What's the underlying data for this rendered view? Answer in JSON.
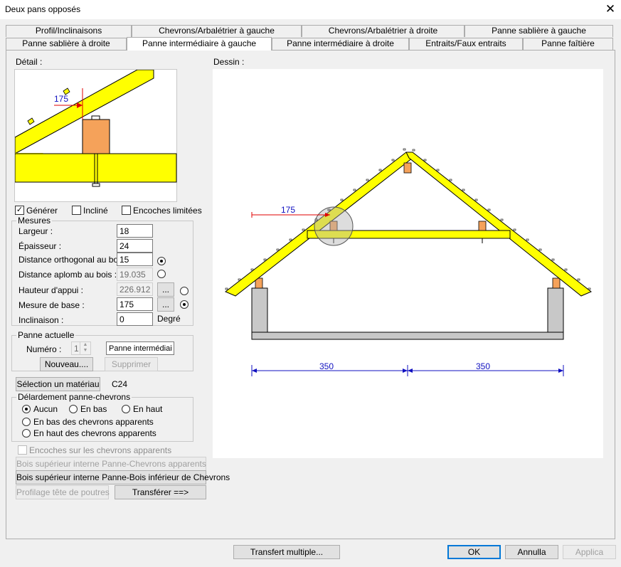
{
  "window": {
    "title": "Deux pans opposés"
  },
  "tabs_row1": [
    "Profil/Inclinaisons",
    "Chevrons/Arbalétrier à gauche",
    "Chevrons/Arbalétrier à droite",
    "Panne sablière à gauche"
  ],
  "tabs_row2": [
    "Panne sablière à droite",
    "Panne intermédiaire à gauche",
    "Panne intermédiaire à droite",
    "Entraits/Faux entraits",
    "Panne faîtière"
  ],
  "detail": {
    "label": "Détail :",
    "dim": "175"
  },
  "drawing": {
    "label": "Dessin :",
    "dim_left": "175",
    "span_left": "350",
    "span_right": "350"
  },
  "options": {
    "generer": "Générer",
    "incline": "Incliné",
    "encoches": "Encoches limitées"
  },
  "mesures": {
    "title": "Mesures",
    "largeur_label": "Largeur :",
    "largeur": "18",
    "epaisseur_label": "Épaisseur :",
    "epaisseur": "24",
    "dist_ortho_label": "Distance orthogonal au bois :",
    "dist_ortho": "15",
    "dist_aplomb_label": "Distance aplomb au bois :",
    "dist_aplomb": "19.035",
    "hauteur_label": "Hauteur d'appui :",
    "hauteur": "226.912",
    "mesure_base_label": "Mesure de base :",
    "mesure_base": "175",
    "inclinaison_label": "Inclinaison :",
    "inclinaison": "0",
    "degre": "Degré",
    "ellipsis": "..."
  },
  "panne": {
    "title": "Panne actuelle",
    "numero_label": "Numéro :",
    "numero": "1",
    "nom": "Panne intermédiaire",
    "nouveau": "Nouveau....",
    "supprimer": "Supprimer"
  },
  "materiau": {
    "button": "Sélection un matériau",
    "value": "C24"
  },
  "delardement": {
    "title": "Délardement panne-chevrons",
    "aucun": "Aucun",
    "en_bas": "En bas",
    "en_haut": "En haut",
    "bas_app": "En bas des chevrons apparents",
    "haut_app": "En haut des chevrons apparents"
  },
  "encoches_app": "Encoches sur les chevrons apparents",
  "actions": {
    "bois_sup_chev": "Bois supérieur interne Panne-Chevrons apparents",
    "bois_sup_inf": "Bois supérieur interne Panne-Bois inférieur de Chevrons",
    "profilage": "Profilage tête de poutres",
    "transferer": "Transférer ==>"
  },
  "footer": {
    "transfert": "Transfert multiple...",
    "ok": "OK",
    "annulla": "Annulla",
    "applica": "Applica"
  }
}
